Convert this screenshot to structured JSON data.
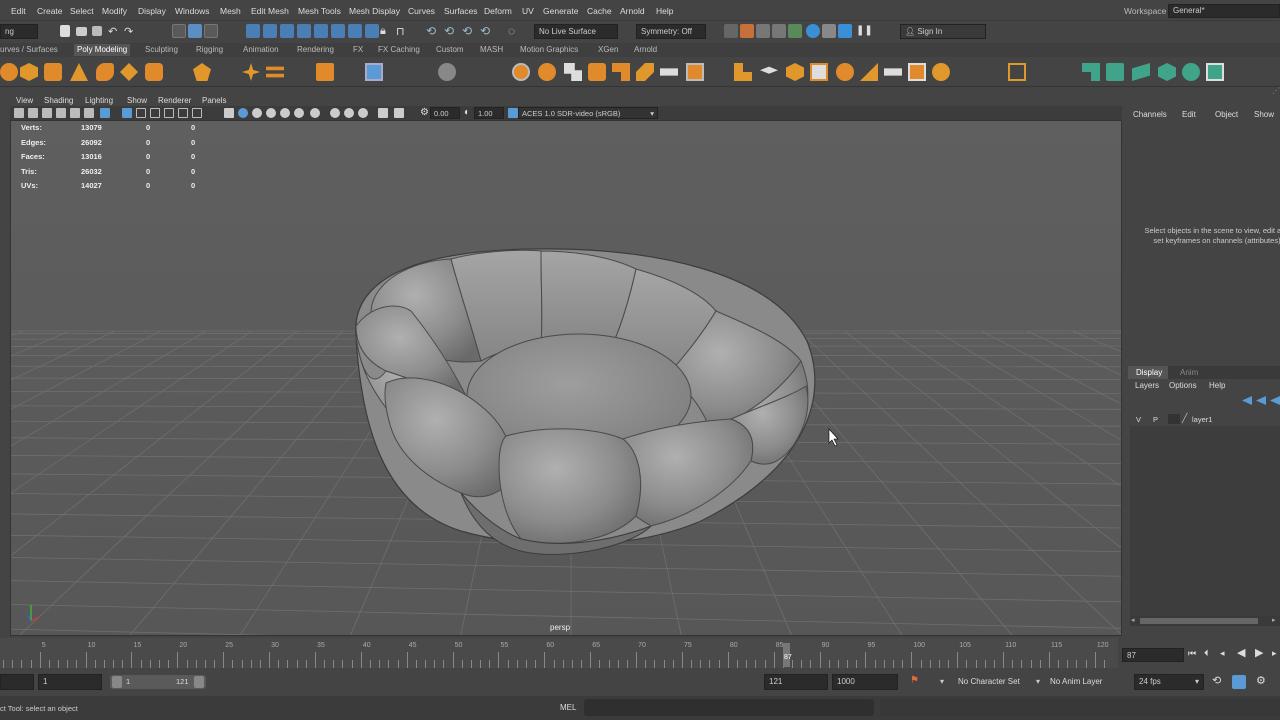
{
  "menubar": {
    "items": [
      "Edit",
      "Create",
      "Select",
      "Modify",
      "Display",
      "Windows",
      "Mesh",
      "Edit Mesh",
      "Mesh Tools",
      "Mesh Display",
      "Curves",
      "Surfaces",
      "Deform",
      "UV",
      "Generate",
      "Cache",
      "Arnold",
      "Help"
    ],
    "workspace_label": "Workspace :",
    "workspace_value": "General*"
  },
  "statusline": {
    "menuset": "ng",
    "live_surface": "No Live Surface",
    "symmetry": "Symmetry: Off",
    "sign_in": "Sign In"
  },
  "shelf_tabs": [
    "urves / Surfaces",
    "Poly Modeling",
    "Sculpting",
    "Rigging",
    "Animation",
    "Rendering",
    "FX",
    "FX Caching",
    "Custom",
    "MASH",
    "Motion Graphics",
    "XGen",
    "Arnold"
  ],
  "shelf_active": "Poly Modeling",
  "viewport": {
    "menus": [
      "View",
      "Shading",
      "Lighting",
      "Show",
      "Renderer",
      "Panels"
    ],
    "exposure": "0.00",
    "gamma": "1.00",
    "colorspace": "ACES 1.0 SDR-video (sRGB)",
    "camera_label": "persp",
    "hud": [
      {
        "label": "Verts:",
        "v1": "13079",
        "v2": "0",
        "v3": "0"
      },
      {
        "label": "Edges:",
        "v1": "26092",
        "v2": "0",
        "v3": "0"
      },
      {
        "label": "Faces:",
        "v1": "13016",
        "v2": "0",
        "v3": "0"
      },
      {
        "label": "Tris:",
        "v1": "26032",
        "v2": "0",
        "v3": "0"
      },
      {
        "label": "UVs:",
        "v1": "14027",
        "v2": "0",
        "v3": "0"
      }
    ]
  },
  "channelbox": {
    "menus": [
      "Channels",
      "Edit",
      "Object",
      "Show"
    ],
    "hint": "Select objects in the scene to view, edit and set keyframes on channels (attributes)"
  },
  "layers": {
    "tabs": [
      "Display",
      "Anim"
    ],
    "menus": [
      "Layers",
      "Options",
      "Help"
    ],
    "row": {
      "v": "V",
      "p": "P",
      "name": "layer1"
    }
  },
  "timeslider": {
    "ticks": [
      "5",
      "10",
      "15",
      "20",
      "25",
      "30",
      "35",
      "40",
      "45",
      "50",
      "55",
      "60",
      "65",
      "70",
      "75",
      "80",
      "85",
      "90",
      "95",
      "100",
      "105",
      "110",
      "115",
      "120"
    ],
    "current_frame": "87",
    "current_field": "87"
  },
  "range": {
    "start": "1",
    "inner_start": "1",
    "inner_end": "121",
    "end": "121",
    "anim_end": "1000",
    "character_set": "No Character Set",
    "anim_layer": "No Anim Layer",
    "fps": "24 fps"
  },
  "cmdline": {
    "help_text": "ct Tool: select an object",
    "lang": "MEL"
  }
}
